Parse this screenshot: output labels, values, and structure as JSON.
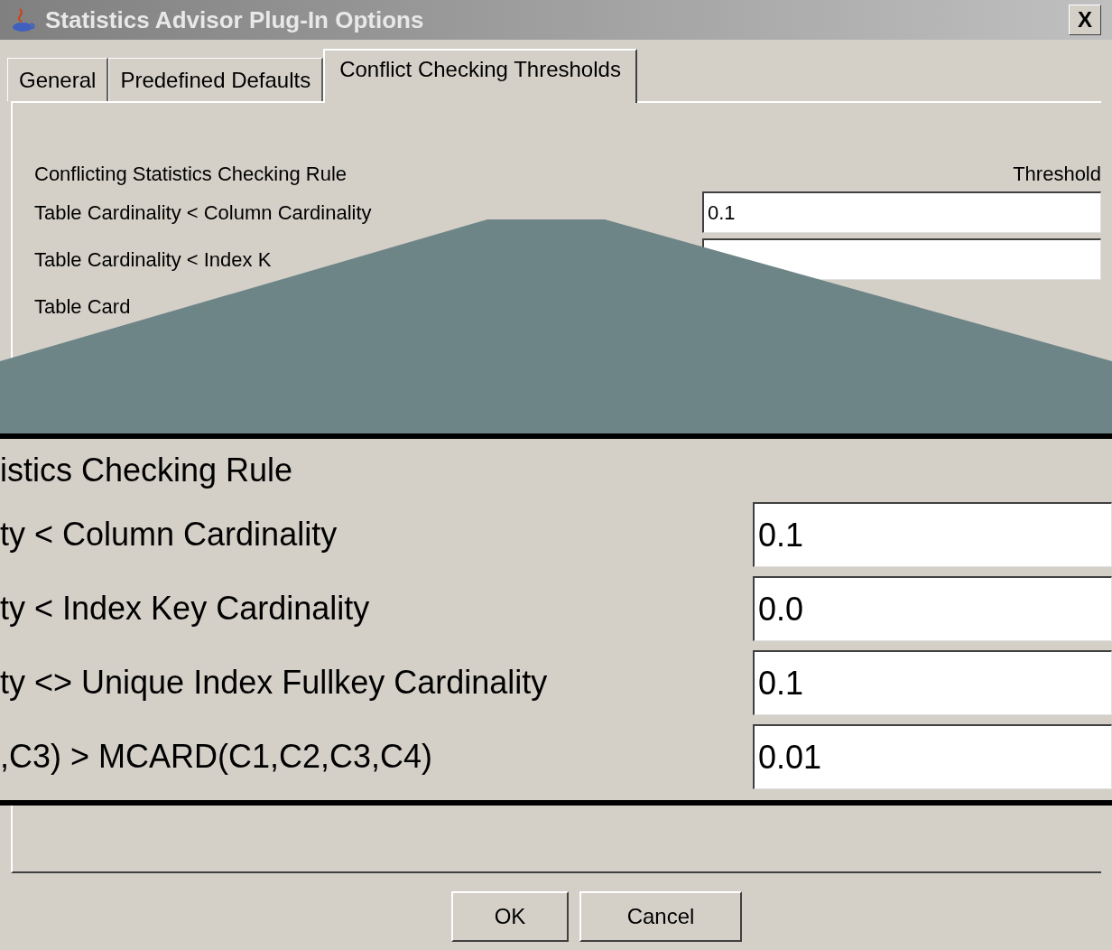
{
  "window": {
    "title": "Statistics Advisor Plug-In Options",
    "close": "X"
  },
  "tabs": [
    {
      "label": "General",
      "selected": false
    },
    {
      "label": "Predefined Defaults",
      "selected": false
    },
    {
      "label": "Conflict Checking Thresholds",
      "selected": true
    }
  ],
  "table": {
    "rule_header": "Conflicting Statistics Checking Rule",
    "threshold_header": "Threshold",
    "rows": [
      {
        "kind": "full",
        "rule": "Table Cardinality < Column Cardinality",
        "threshold": "0.1"
      },
      {
        "kind": "full",
        "rule": "Table Cardinality < Index K"
      },
      {
        "kind": "rule_only",
        "rule": "Table Card"
      }
    ]
  },
  "magnifier": {
    "header": "istics Checking Rule",
    "rows": [
      {
        "rule": "ty < Column Cardinality",
        "threshold": "0.1"
      },
      {
        "rule": "ty < Index Key Cardinality",
        "threshold": "0.0"
      },
      {
        "rule": "ty <> Unique Index Fullkey Cardinality",
        "threshold": "0.1"
      },
      {
        "rule": ",C3) > MCARD(C1,C2,C3,C4)",
        "threshold": "0.01"
      }
    ]
  },
  "buttons": [
    {
      "label": "OK"
    },
    {
      "label": "Cancel"
    }
  ]
}
